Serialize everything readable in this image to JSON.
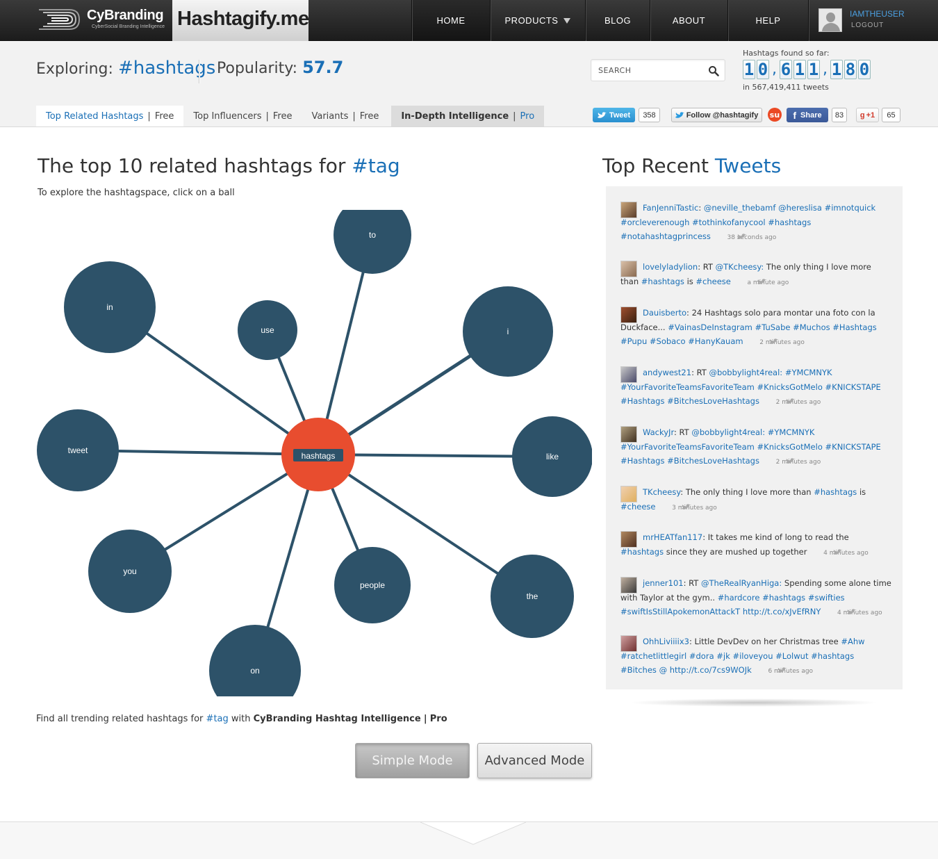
{
  "brand": {
    "cybranding": "CyBranding",
    "cybranding_tagline": "CyberSocial Branding Intelligence",
    "site": "Hashtagify.me"
  },
  "nav": {
    "items": [
      {
        "label": "HOME"
      },
      {
        "label": "PRODUCTS"
      },
      {
        "label": "BLOG"
      },
      {
        "label": "ABOUT"
      },
      {
        "label": "HELP"
      }
    ]
  },
  "user": {
    "name": "IAMTHEUSER",
    "logout": "LOGOUT"
  },
  "header": {
    "exploring_label": "Exploring:",
    "exploring_tag": "#hashtags",
    "popularity_label": "Popularity:",
    "popularity_value": "57.7",
    "search_placeholder": "SEARCH",
    "found_label": "Hashtags found so far:",
    "found_digits": [
      "1",
      "0",
      ",",
      "6",
      "1",
      "1",
      ",",
      "1",
      "8",
      "0"
    ],
    "found_sub": "in 567,419,411 tweets"
  },
  "tabs": [
    {
      "label": "Top Related Hashtags",
      "tier": "Free"
    },
    {
      "label": "Top Influencers",
      "tier": "Free"
    },
    {
      "label": "Variants",
      "tier": "Free"
    },
    {
      "label": "In-Depth Intelligence",
      "tier": "Pro"
    }
  ],
  "social": {
    "tweet_label": "Tweet",
    "tweet_count": "358",
    "follow_label": "Follow @hashtagify",
    "share_label": "Share",
    "share_count": "83",
    "gplus_label": "+1",
    "gplus_count": "65"
  },
  "main": {
    "title_prefix": "The top 10 related hashtags for",
    "title_tag": "#tag",
    "subtitle": "To explore the hashtagspace, click on a ball",
    "graph": {
      "center": "hashtags",
      "nodes": [
        "to",
        "in",
        "use",
        "i",
        "tweet",
        "like",
        "you",
        "people",
        "the",
        "on"
      ]
    },
    "pro_line": {
      "prefix": "Find all trending related hashtags for",
      "tag": "#tag",
      "middle": "with",
      "product": "CyBranding Hashtag Intelligence",
      "pipe": "|",
      "pro": "Pro"
    },
    "simple_mode": "Simple Mode",
    "advanced_mode": "Advanced Mode"
  },
  "tweets": {
    "title_prefix": "Top Recent",
    "title_accent": "Tweets",
    "items": [
      {
        "user": "FanJenniTastic",
        "text": "@neville_thebamf @hereslisa #imnotquick #orcleverenough #tothinkofanycool #hashtags #notahashtagprincess",
        "time": "38 seconds ago"
      },
      {
        "user": "lovelyladylion",
        "text": "RT @TKcheesy: The only thing I love more than #hashtags is #cheese",
        "time": "a minute ago"
      },
      {
        "user": "Dauisberto",
        "text": "24 Hashtags solo para montar una foto con la Duckface... #VainasDeInstagram #TuSabe #Muchos #Hashtags #Pupu #Sobaco #HanyKauam",
        "time": "2 minutes ago"
      },
      {
        "user": "andywest21",
        "text": "RT @bobbylight4real: #YMCMNYK #YourFavoriteTeamsFavoriteTeam #KnicksGotMelo #KNICKSTAPE #Hashtags #BitchesLoveHashtags",
        "time": "2 minutes ago"
      },
      {
        "user": "WackyJr",
        "text": "RT @bobbylight4real: #YMCMNYK #YourFavoriteTeamsFavoriteTeam #KnicksGotMelo #KNICKSTAPE #Hashtags #BitchesLoveHashtags",
        "time": "2 minutes ago"
      },
      {
        "user": "TKcheesy",
        "text": "The only thing I love more than #hashtags is #cheese",
        "time": "3 minutes ago"
      },
      {
        "user": "mrHEATfan117",
        "text": "It takes me kind of long to read the #hashtags since they are mushed up together",
        "time": "4 minutes ago"
      },
      {
        "user": "jenner101",
        "text": "RT @TheRealRyanHiga: Spending some alone time with Taylor at the gym.. #hardcore #hashtags #swifties #swiftIsStillApokemonAttackT http://t.co/xJvEfRNY",
        "time": "4 minutes ago"
      },
      {
        "user": "OhhLiviiiix3",
        "text": "Little DevDev on her Christmas tree #Ahw #ratchetlittlegirl #dora #jk #iloveyou #Lolwut #hashtags #Bitches @ http://t.co/7cs9WOJk",
        "time": "6 minutes ago"
      }
    ]
  },
  "colors": {
    "accent": "#1a6fb6",
    "node": "#2d5269",
    "center": "#e84d2f",
    "edge": "#2d5269"
  }
}
